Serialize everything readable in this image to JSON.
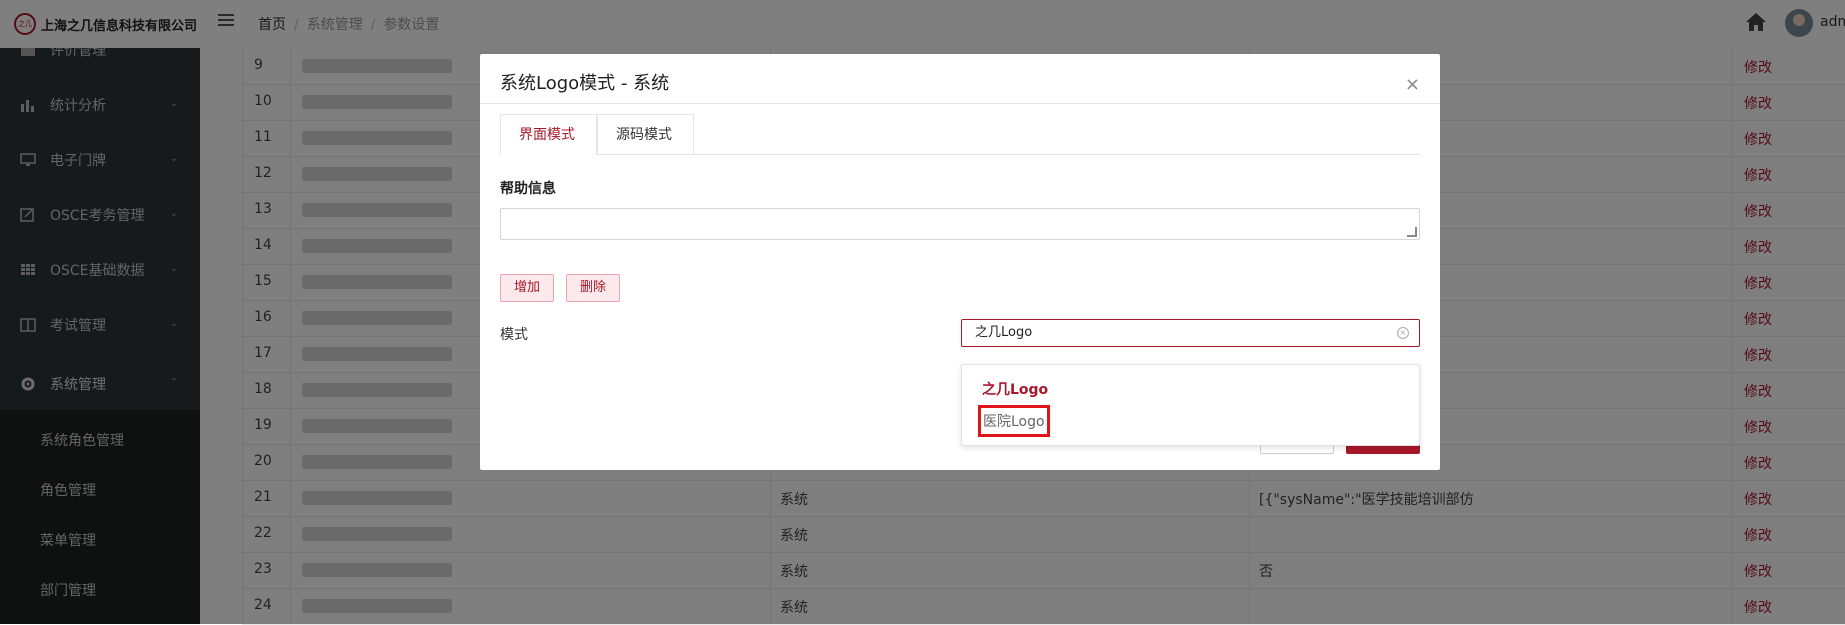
{
  "brand": {
    "logo_text": "之几",
    "name": "上海之几信息科技有限公司"
  },
  "sidebar": {
    "items": [
      {
        "label": "评价管理"
      },
      {
        "label": "统计分析"
      },
      {
        "label": "电子门牌"
      },
      {
        "label": "OSCE考务管理"
      },
      {
        "label": "OSCE基础数据"
      },
      {
        "label": "考试管理"
      },
      {
        "label": "系统管理"
      }
    ],
    "sub_items": [
      {
        "label": "系统角色管理"
      },
      {
        "label": "角色管理"
      },
      {
        "label": "菜单管理"
      },
      {
        "label": "部门管理"
      }
    ]
  },
  "header": {
    "breadcrumb": [
      "首页",
      "系统管理",
      "参数设置"
    ],
    "username": "adm"
  },
  "table": {
    "action_label": "修改",
    "rows": [
      {
        "idx": "9",
        "type": "",
        "value": ""
      },
      {
        "idx": "10",
        "type": "",
        "value": ""
      },
      {
        "idx": "11",
        "type": "",
        "value": ""
      },
      {
        "idx": "12",
        "type": "",
        "value": ""
      },
      {
        "idx": "13",
        "type": "",
        "value": ""
      },
      {
        "idx": "14",
        "type": "",
        "value": ""
      },
      {
        "idx": "15",
        "type": "",
        "value": ""
      },
      {
        "idx": "16",
        "type": "",
        "value": ""
      },
      {
        "idx": "17",
        "type": "",
        "value": ""
      },
      {
        "idx": "18",
        "type": "",
        "value": ""
      },
      {
        "idx": "19",
        "type": "",
        "value": ""
      },
      {
        "idx": "20",
        "type": "",
        "value": ""
      },
      {
        "idx": "21",
        "type": "系统",
        "value": "[{\"sysName\":\"医学技能培训部仿"
      },
      {
        "idx": "22",
        "type": "系统",
        "value": ""
      },
      {
        "idx": "23",
        "type": "系统",
        "value": "否"
      },
      {
        "idx": "24",
        "type": "系统",
        "value": ""
      }
    ]
  },
  "modal": {
    "title": "系统Logo模式 - 系统",
    "close_label": "×",
    "tabs": [
      {
        "label": "界面模式",
        "active": true
      },
      {
        "label": "源码模式",
        "active": false
      }
    ],
    "help_label": "帮助信息",
    "add_label": "增加",
    "delete_label": "删除",
    "mode_label": "模式",
    "mode_value": "之几Logo",
    "options": [
      {
        "label": "之几Logo",
        "selected": true
      },
      {
        "label": "医院Logo",
        "selected": false
      }
    ]
  },
  "colors": {
    "accent": "#a8172a",
    "sidebar_bg": "#2f3436",
    "highlight_box": "#e0151c"
  }
}
